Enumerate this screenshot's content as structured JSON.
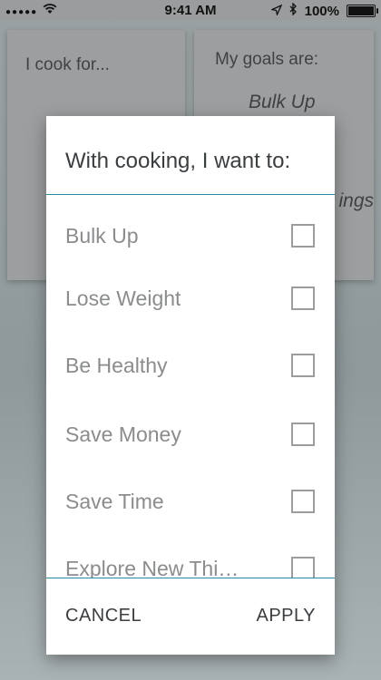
{
  "status_bar": {
    "signal": "●●●●●",
    "time": "9:41 AM",
    "battery": "100%"
  },
  "background": {
    "cook_card": {
      "label": "I cook for..."
    },
    "goals_card": {
      "label": "My goals are:",
      "value": "Bulk Up",
      "value_partial": "ings"
    }
  },
  "modal": {
    "title": "With cooking, I want to:",
    "options": [
      {
        "label": "Bulk Up",
        "checked": false
      },
      {
        "label": "Lose Weight",
        "checked": false
      },
      {
        "label": "Be Healthy",
        "checked": false
      },
      {
        "label": "Save Money",
        "checked": false
      },
      {
        "label": "Save Time",
        "checked": false
      },
      {
        "label": "Explore New Thi…",
        "checked": false
      }
    ],
    "cancel_label": "CANCEL",
    "apply_label": "APPLY"
  },
  "colors": {
    "accent": "#2a8aa3",
    "overlay": "#9aa1a3",
    "text_dark": "#3b3e40",
    "text_muted": "#8a8c8e"
  }
}
